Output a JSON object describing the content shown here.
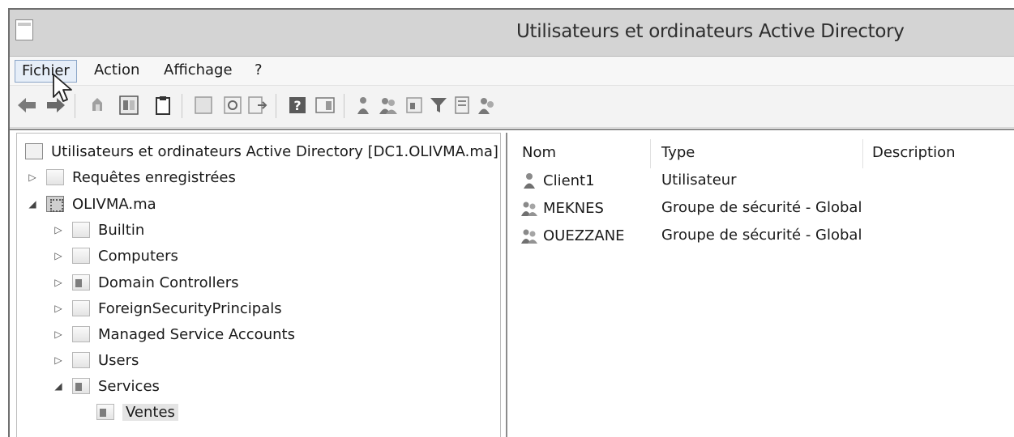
{
  "window": {
    "title": "Utilisateurs et ordinateurs Active Directory"
  },
  "menu": {
    "items": [
      {
        "label": "Fichier"
      },
      {
        "label": "Action"
      },
      {
        "label": "Affichage"
      },
      {
        "label": "?"
      }
    ]
  },
  "toolbar": {
    "icons": [
      "back-arrow-icon",
      "forward-arrow-icon",
      "up-folder-icon",
      "show-hide-tree-icon",
      "clipboard-icon",
      "properties-icon",
      "refresh-icon",
      "export-list-icon",
      "help-icon",
      "action-pane-icon",
      "new-user-icon",
      "new-group-icon",
      "new-ou-icon",
      "filter-icon",
      "find-icon",
      "add-to-group-icon"
    ]
  },
  "tree": {
    "root": "Utilisateurs et ordinateurs Active Directory [DC1.OLIVMA.ma]",
    "saved_queries": "Requêtes enregistrées",
    "domain": "OLIVMA.ma",
    "children": [
      {
        "label": "Builtin"
      },
      {
        "label": "Computers"
      },
      {
        "label": "Domain Controllers"
      },
      {
        "label": "ForeignSecurityPrincipals"
      },
      {
        "label": "Managed Service Accounts"
      },
      {
        "label": "Users"
      },
      {
        "label": "Services"
      }
    ],
    "selected": "Ventes"
  },
  "list": {
    "columns": {
      "name": "Nom",
      "type": "Type",
      "description": "Description"
    },
    "rows": [
      {
        "name": "Client1",
        "type": "Utilisateur",
        "icon": "user-icon"
      },
      {
        "name": "MEKNES",
        "type": "Groupe de sécurité - Global",
        "icon": "group-icon"
      },
      {
        "name": "OUEZZANE",
        "type": "Groupe de sécurité - Global",
        "icon": "group-icon"
      }
    ]
  }
}
